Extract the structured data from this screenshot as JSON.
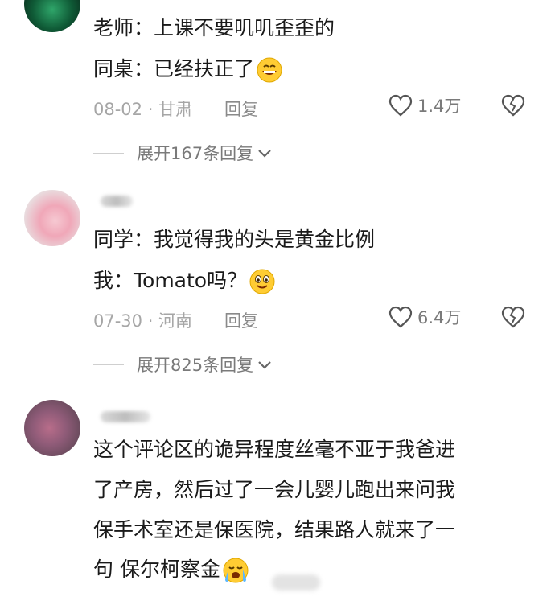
{
  "comments": [
    {
      "lines": [
        "老师：上课不要叽叽歪歪的",
        "同桌：已经扶正了"
      ],
      "date_location": "08-02 · 甘肃",
      "reply_label": "回复",
      "likes": "1.4万",
      "expand_label": "展开167条回复"
    },
    {
      "lines": [
        "同学：我觉得我的头是黄金比例",
        "我：Tomato吗？"
      ],
      "date_location": "07-30 · 河南",
      "reply_label": "回复",
      "likes": "6.4万",
      "expand_label": "展开825条回复"
    },
    {
      "lines": [
        "这个评论区的诡异程度丝毫不亚于我爸进",
        "了产房，然后过了一会儿婴儿跑出来问我",
        "保手术室还是保医院，结果路人就来了一",
        "句  保尔柯察金"
      ]
    }
  ],
  "icons": [
    "heart-outline-icon",
    "broken-heart-icon",
    "chevron-down-icon",
    "grinning-emoji",
    "smiling-emoji",
    "crying-emoji"
  ],
  "colors": {
    "text": "#1a1a1a",
    "meta": "#a6a6a6",
    "action": "#7a7a7a",
    "divider": "#cfcfcf",
    "emoji": "#ffcc33"
  }
}
